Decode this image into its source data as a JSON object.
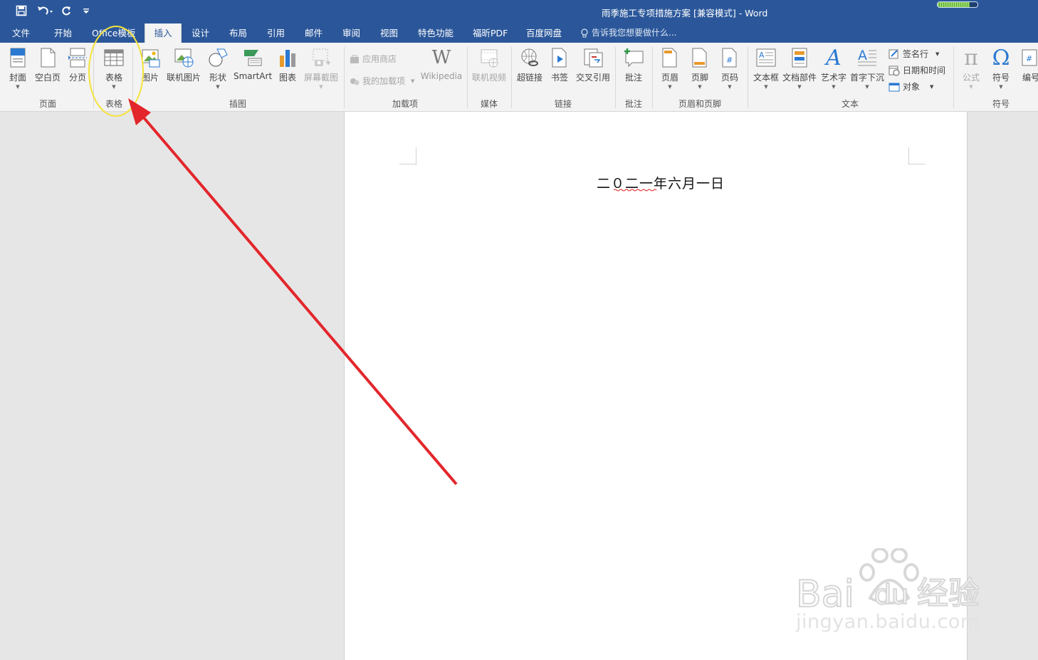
{
  "window": {
    "title": "雨季施工专项措施方案 [兼容模式] - Word",
    "progress": 0.8
  },
  "qat": {
    "save_icon": "save-icon",
    "undo_icon": "undo-icon",
    "redo_icon": "redo-icon",
    "customize_icon": "customize-qat-icon"
  },
  "tabs": [
    {
      "label": "文件"
    },
    {
      "label": "开始"
    },
    {
      "label": "Office模板"
    },
    {
      "label": "插入",
      "active": true
    },
    {
      "label": "设计"
    },
    {
      "label": "布局"
    },
    {
      "label": "引用"
    },
    {
      "label": "邮件"
    },
    {
      "label": "审阅"
    },
    {
      "label": "视图"
    },
    {
      "label": "特色功能"
    },
    {
      "label": "福昕PDF"
    },
    {
      "label": "百度网盘"
    }
  ],
  "tell_me": {
    "placeholder": "告诉我您想要做什么..."
  },
  "ribbon": {
    "pages": {
      "group": "页面",
      "cover": "封面",
      "blank": "空白页",
      "break": "分页"
    },
    "tables": {
      "group": "表格",
      "table": "表格"
    },
    "illustrations": {
      "group": "插图",
      "picture": "图片",
      "online_picture": "联机图片",
      "shapes": "形状",
      "smartart": "SmartArt",
      "chart": "图表",
      "screenshot": "屏幕截图"
    },
    "addins": {
      "group": "加载项",
      "store": "应用商店",
      "my_addins": "我的加载项",
      "wikipedia": "Wikipedia"
    },
    "media": {
      "group": "媒体",
      "online_video": "联机视频"
    },
    "links": {
      "group": "链接",
      "hyperlink": "超链接",
      "bookmark": "书签",
      "cross_ref": "交叉引用"
    },
    "comments": {
      "group": "批注",
      "comment": "批注"
    },
    "header_footer": {
      "group": "页眉和页脚",
      "header": "页眉",
      "footer": "页脚",
      "page_number": "页码"
    },
    "text": {
      "group": "文本",
      "textbox": "文本框",
      "quick_parts": "文档部件",
      "wordart": "艺术字",
      "dropcap": "首字下沉",
      "signature": "签名行",
      "datetime": "日期和时间",
      "object": "对象"
    },
    "symbols": {
      "group": "符号",
      "equation": "公式",
      "symbol": "符号",
      "numbering": "编号"
    }
  },
  "document": {
    "date_line": "二０二一年六月一日"
  },
  "annotation": {
    "highlight_color": "#f5e33a",
    "arrow_color": "#e3262b"
  },
  "watermark": {
    "logo": "Bai du 经验",
    "url": "jingyan.baidu.com"
  }
}
